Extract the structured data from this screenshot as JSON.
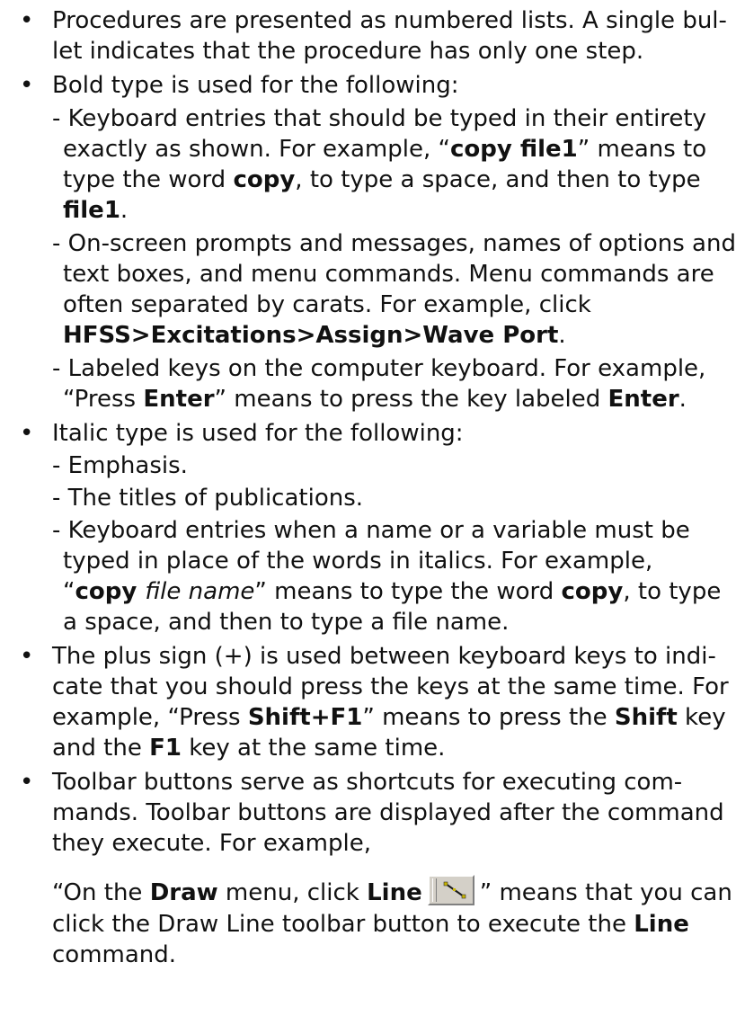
{
  "bullet_glyph": "•",
  "lines": [
    {
      "bullet": true,
      "text": "Procedures are presented as numbered lists. A single bul-"
    },
    {
      "text": "let indicates that the procedure has only one step."
    },
    {
      "bullet": true,
      "text": "Bold type is used for the following:"
    },
    {
      "text": "- Keyboard entries that should be typed in their entirety"
    },
    {
      "text": "exactly as shown. For example, “",
      "b1": "copy file1",
      "t2": "” means to"
    },
    {
      "text": "type the word ",
      "b1": "copy",
      "t2": ", to type a space, and then to type"
    },
    {
      "b1": "file1",
      "t2": "."
    },
    {
      "text": "- On-screen prompts and messages, names of options and"
    },
    {
      "text": "text boxes, and menu commands. Menu commands are"
    },
    {
      "text": "often separated by carats. For example, click"
    },
    {
      "b1": "HFSS>Excitations>Assign>Wave Port",
      "t2": "."
    },
    {
      "text": "- Labeled keys on the computer keyboard. For example,"
    },
    {
      "text": "“Press ",
      "b1": "Enter",
      "t2": "” means to press the key labeled ",
      "b2": "Enter",
      "t3": "."
    },
    {
      "bullet": true,
      "text": "Italic type is used for the following:"
    },
    {
      "text": "- Emphasis."
    },
    {
      "text": "- The titles of publications."
    },
    {
      "text": "- Keyboard entries when a name or a variable must be"
    },
    {
      "text": "typed in place of the words in italics. For example,"
    },
    {
      "text": "“",
      "b1": "copy ",
      "i1": "file name",
      "t2": "” means to type the word ",
      "b2": "copy",
      "t3": ", to type"
    },
    {
      "text": "a space, and then to type a file name."
    },
    {
      "bullet": true,
      "text": "The plus sign (+) is used between keyboard keys to indi-"
    },
    {
      "text": "cate that you should press the keys at the same time. For"
    },
    {
      "text": "example, “Press ",
      "b1": "Shift+F1",
      "t2": "” means to press the ",
      "b2": "Shift",
      "t3": " key"
    },
    {
      "text": "and the ",
      "b1": "F1",
      "t2": " key at the same time."
    },
    {
      "bullet": true,
      "text": "Toolbar buttons serve as shortcuts for executing com-"
    },
    {
      "text": "mands. Toolbar buttons are displayed after the command"
    },
    {
      "text": "they execute. For example,"
    },
    {
      "text": "“On the ",
      "b1": "Draw",
      "t2": " menu, click ",
      "b2": "Line",
      "t3": "",
      "t4": "” means that you can"
    },
    {
      "text": "click the Draw Line toolbar button to execute the ",
      "b1": "Line"
    },
    {
      "text": "command."
    }
  ]
}
